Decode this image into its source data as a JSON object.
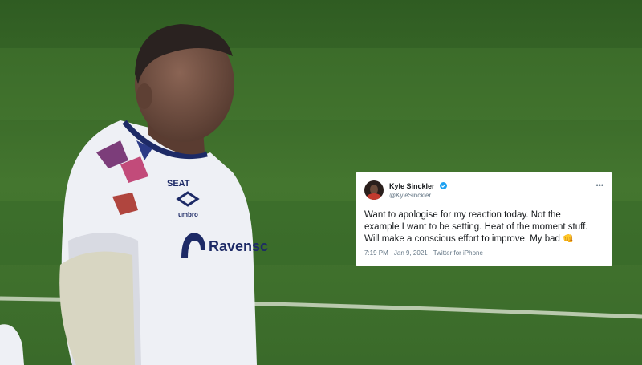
{
  "tweet": {
    "display_name": "Kyle Sinckler",
    "handle": "@KyleSinckler",
    "text_line1": "Want to apologise for my reaction today. Not the",
    "text_line2": "example I want to be setting. Heat of the moment stuff.",
    "text_line3": "Will make a conscious effort to improve. My bad",
    "emoji": "👊",
    "time": "7:19 PM",
    "date": "Jan 9, 2021",
    "source": "Twitter for iPhone",
    "more": "•••"
  },
  "jersey": {
    "sponsor": "Ravensc",
    "brand": "umbro"
  },
  "colors": {
    "pitch": "#3d6a2b",
    "verified": "#1da1f2",
    "jersey": "#eef0f5",
    "jersey_trim": "#1d2a66"
  }
}
